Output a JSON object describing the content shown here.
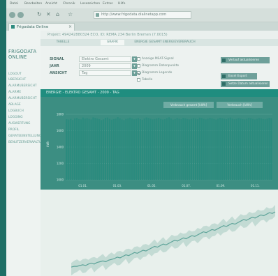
{
  "browser": {
    "menu": [
      "Datei",
      "Bearbeiten",
      "Ansicht",
      "Chronik",
      "Lesezeichen",
      "Extras",
      "Hilfe"
    ],
    "address": "http://www.frigodata.dialinetapp.com",
    "tab_title": "Frigodata Online"
  },
  "app": {
    "logo_line1": "FRIGODATA",
    "logo_line2": "ONLINE",
    "nav": [
      "LOGOUT",
      "UBERSICHT",
      "ALARMUBERSICHT",
      "ALARME",
      "ALARMUBERSICHT",
      "ABLAGE",
      "LOGBUCH",
      "LOGGING",
      "AUSWERTUNG",
      "PROFIL",
      "GERATEEINSTELLUNGEN",
      "BENUTZERVERWALTUNG"
    ],
    "project_header": "Projekt: 494242880324 ECO, ID: REMA 234 Berlin Bremen (7.0015)",
    "subtabs": [
      "TABELLE",
      "GRAFIK",
      "ENERGIE GESAMT ENERGIEVERBRAUCH"
    ]
  },
  "form": {
    "signal_label": "SIGNAL",
    "signal_value": "Elektro Gesamt",
    "year_label": "JAHR",
    "year_value": "2009",
    "period_label": "ANSICHT",
    "period_value": "Tag",
    "checkboxes": [
      {
        "label": "Anzeige MSAT-Signal",
        "checked": false
      },
      {
        "label": "Diagramm Datenpunkte",
        "checked": false
      },
      {
        "label": "Diagramm Legende",
        "checked": true
      },
      {
        "label": "Tabelle",
        "checked": false
      }
    ],
    "buttons": [
      "Verlauf aktualisieren",
      "Excel Export",
      "Setze Datum aktualisieren"
    ]
  },
  "chart": {
    "title": "ENERGIE - ELEKTRO GESAMT - 2009 - TAG",
    "legend": [
      "Verbrauch gesamt [kWh]",
      "Verbrauch [kWh]"
    ],
    "colors": {
      "bar": "#2a8b7e",
      "panel": "#3c8e82",
      "header": "#1f8d7f",
      "trend": "#5fa49a",
      "band": "#b3d1cb"
    }
  },
  "chart_data": [
    {
      "type": "bar",
      "title": "ENERGIE - ELEKTRO GESAMT - 2009 - TAG",
      "ylabel": "kWh",
      "yticks": [
        1000,
        1200,
        1400,
        1600,
        1800
      ],
      "xticks": [
        "01.01.",
        "01.03.",
        "01.05.",
        "01.07.",
        "01.09.",
        "01.11."
      ],
      "ylim": [
        1000,
        1800
      ],
      "series": [
        {
          "name": "Verbrauch gesamt [kWh]",
          "values": [
            1740,
            1735,
            1745,
            1730,
            1750,
            1755,
            1742,
            1738,
            1760,
            1748,
            1752,
            1744,
            1736,
            1762,
            1755,
            1749,
            1741,
            1730,
            1738,
            1757,
            1760,
            1745,
            1734,
            1742,
            1748,
            1765,
            1751,
            1737,
            1729,
            1744,
            1750,
            1759,
            1748,
            1739,
            1746,
            1753,
            1740,
            1733,
            1749,
            1761,
            1755,
            1747,
            1738,
            1742,
            1750,
            1758,
            1744,
            1736,
            1740,
            1752,
            1763,
            1749,
            1735,
            1741,
            1754,
            1746,
            1739,
            1756,
            1750,
            1743,
            1737,
            1745,
            1752,
            1748,
            1741,
            1759,
            1753,
            1744,
            1738,
            1747,
            1755,
            1750,
            1742,
            1736,
            1748,
            1757,
            1751,
            1746,
            1740,
            1752,
            1760,
            1747,
            1739,
            1744,
            1753,
            1749,
            1741,
            1738,
            1746,
            1758,
            1752,
            1743,
            1737,
            1745,
            1754,
            1750,
            1742,
            1739,
            1748,
            1756,
            1751
          ]
        }
      ]
    },
    {
      "type": "line",
      "series": [
        {
          "name": "Verbrauch [kWh]",
          "values": [
            8,
            9,
            9,
            10,
            11,
            10,
            12,
            13,
            12,
            14,
            15,
            16,
            15,
            17,
            18,
            19,
            21,
            20,
            22,
            24,
            23,
            25,
            27,
            26,
            28,
            30,
            29,
            31,
            33,
            35,
            34,
            36,
            38,
            37,
            39,
            41,
            43,
            42,
            44,
            46,
            45,
            47,
            49,
            48,
            50,
            52,
            54,
            53,
            55,
            57,
            56,
            58,
            60,
            62,
            61,
            63,
            65,
            64,
            66,
            68,
            70,
            69,
            71,
            73,
            72,
            74,
            76,
            75,
            77,
            79,
            78,
            80
          ]
        }
      ]
    }
  ]
}
